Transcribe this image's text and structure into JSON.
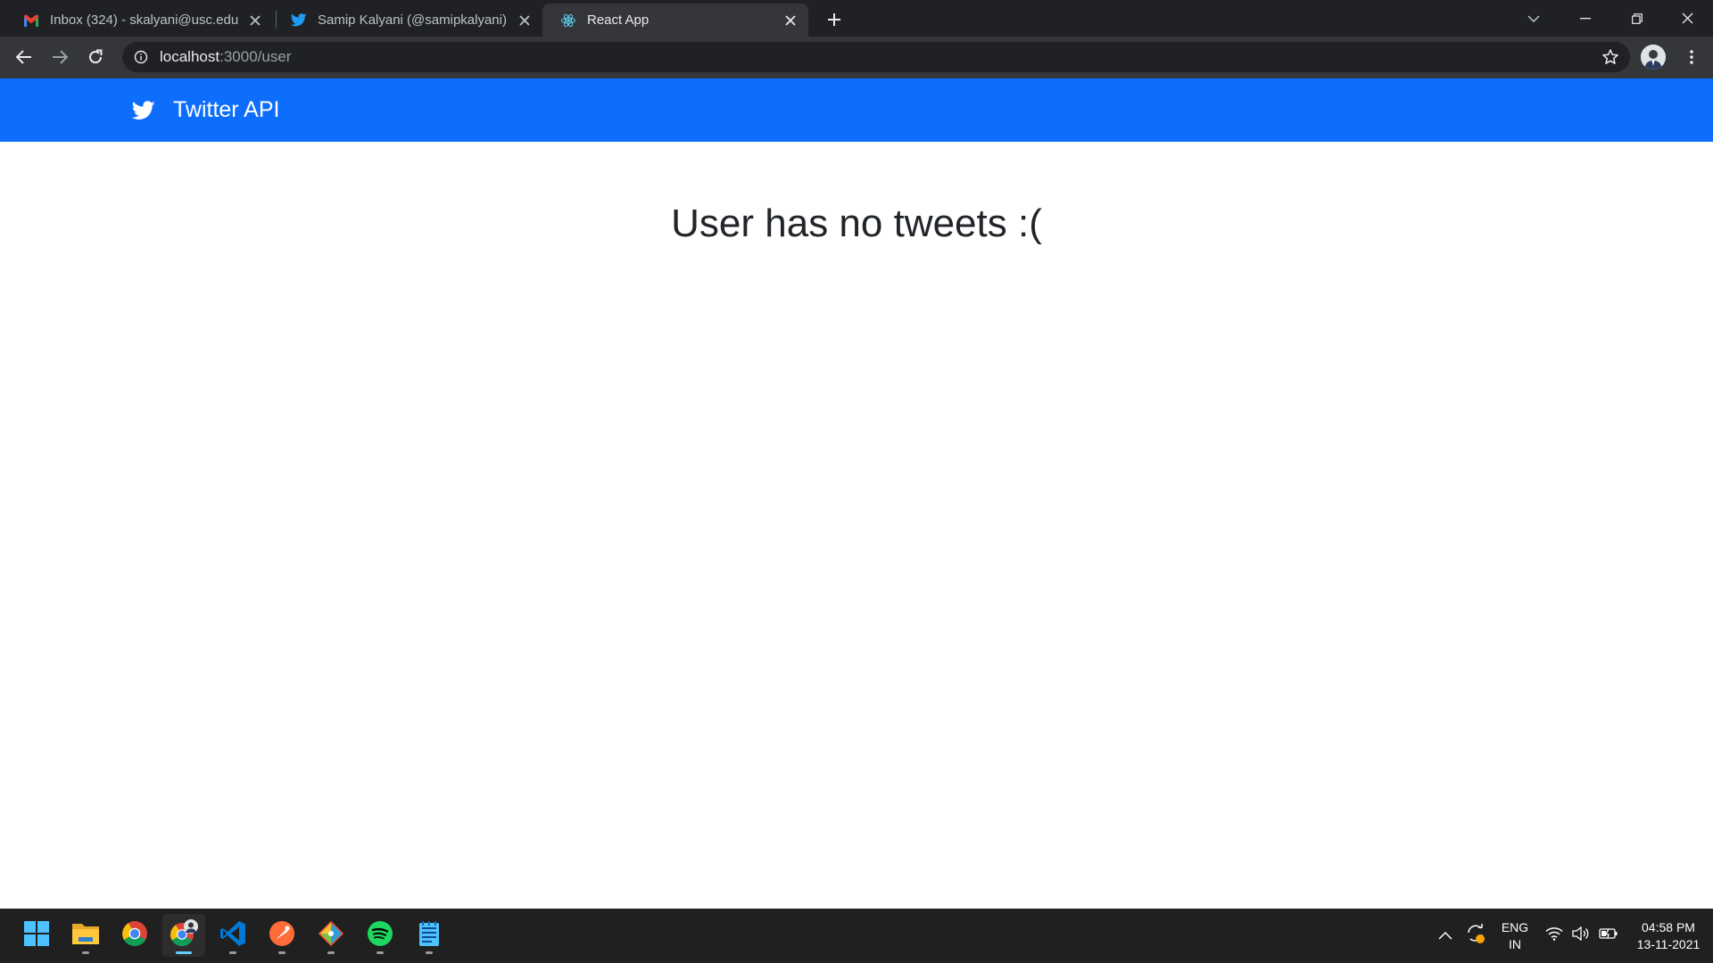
{
  "browser": {
    "tabs": [
      {
        "title": "Inbox (324) - skalyani@usc.edu -",
        "favicon": "gmail-icon",
        "active": false
      },
      {
        "title": "Samip Kalyani (@samipkalyani) /",
        "favicon": "twitter-icon",
        "active": false
      },
      {
        "title": "React App",
        "favicon": "react-icon",
        "active": true
      }
    ],
    "url_host": "localhost",
    "url_rest": ":3000/user"
  },
  "app": {
    "brand": "Twitter API",
    "message": "User has no tweets :(",
    "navbar_color": "#0d6efd"
  },
  "taskbar": {
    "apps": [
      "start-icon",
      "file-explorer-icon",
      "chrome-icon",
      "chrome-profile-icon",
      "vscode-icon",
      "postman-icon",
      "git-icon",
      "spotify-icon",
      "notepad-icon"
    ],
    "lang_line1": "ENG",
    "lang_line2": "IN",
    "time": "04:58 PM",
    "date": "13-11-2021"
  }
}
